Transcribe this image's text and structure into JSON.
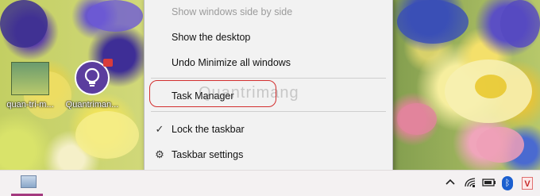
{
  "desktop": {
    "icons": [
      {
        "label": "quan-tri-m..."
      },
      {
        "label": "Quantriman..."
      }
    ]
  },
  "context_menu": {
    "items": [
      {
        "label": "Show windows side by side",
        "disabled": true
      },
      {
        "label": "Show the desktop"
      },
      {
        "label": "Undo Minimize all windows"
      },
      {
        "label": "Task Manager",
        "highlighted": true
      },
      {
        "label": "Lock the taskbar",
        "checked": true,
        "icon": "checkmark-icon"
      },
      {
        "label": "Taskbar settings",
        "icon": "gear-icon"
      }
    ]
  },
  "watermark": "Quantrimang",
  "taskbar": {
    "running_app_icon": "picture-app-icon",
    "tray_icons": [
      "chevron-up-icon",
      "wifi-icon",
      "battery-icon",
      "bluetooth-icon",
      "v-app-icon"
    ],
    "bluetooth_glyph": "ᛒ",
    "v_app_label": "V"
  },
  "colors": {
    "menu_background": "#f2f2f2",
    "highlight_ring": "#d32f2f",
    "taskbar_accent": "#a4397f"
  }
}
